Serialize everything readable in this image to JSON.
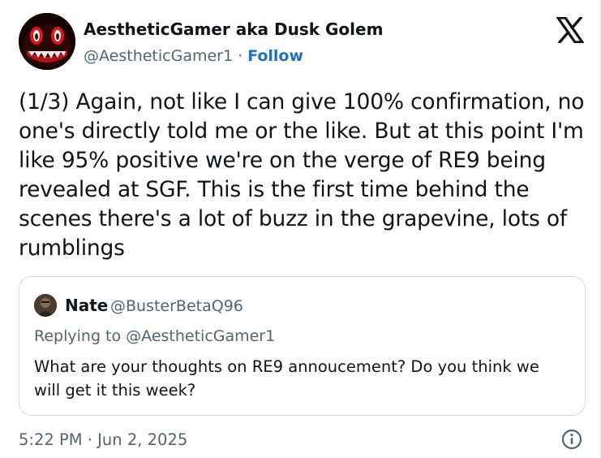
{
  "author": {
    "name": "AestheticGamer aka Dusk Golem",
    "handle": "@AestheticGamer1",
    "separator": "·",
    "follow_label": "Follow"
  },
  "tweet": {
    "text": "(1/3) Again, not like I can give 100% confirmation, no one's directly told me or the like. But at this point I'm like 95% positive we're on the verge of RE9 being revealed at SGF. This is the first time behind the scenes there's a lot of buzz in the grapevine, lots of rumblings"
  },
  "quoted": {
    "name": "Nate",
    "handle": "@BusterBetaQ96",
    "replying_to": "Replying to @AestheticGamer1",
    "text": "What are your thoughts on RE9 annoucement? Do you think we will get it this week?"
  },
  "footer": {
    "timestamp": "5:22 PM · Jun 2, 2025"
  },
  "icons": {
    "brand_logo": "x-logo-icon",
    "info": "info-icon"
  },
  "colors": {
    "text_primary": "#0f1419",
    "text_secondary": "#536471",
    "link": "#1d72c6",
    "border": "#cfd9de",
    "avatar_eye": "#e0161a"
  }
}
